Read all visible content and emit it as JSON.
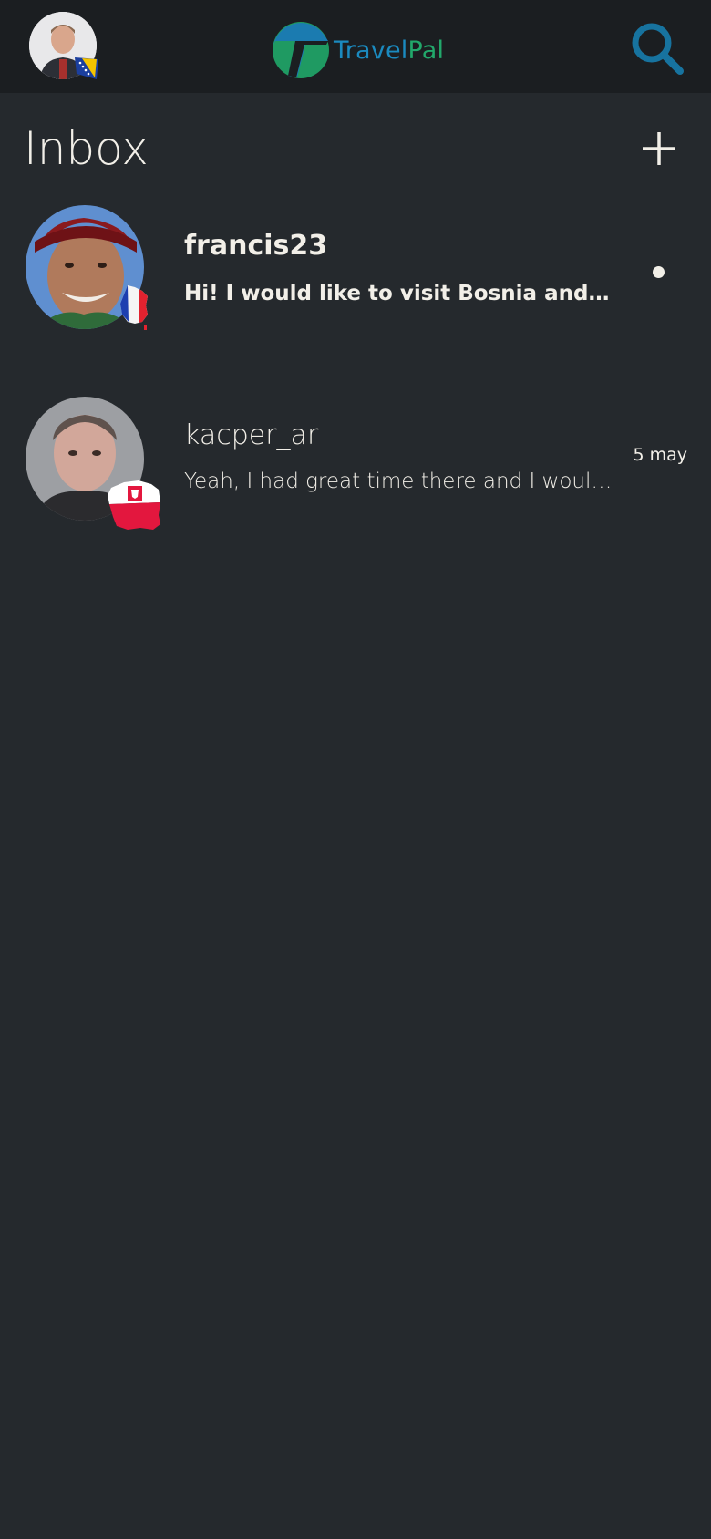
{
  "app": {
    "logo_text_part1": "Travel",
    "logo_text_part2": "Pal",
    "brand_colors": {
      "blue": "#1b8abf",
      "green": "#22a86b"
    }
  },
  "header": {
    "profile_avatar_icon": "user-avatar",
    "profile_flag": "bosnia-flag",
    "search_icon": "search-icon"
  },
  "inbox": {
    "title": "Inbox",
    "new_message_icon": "plus-icon"
  },
  "conversations": [
    {
      "username": "francis23",
      "preview": "Hi! I would like to visit Bosnia and Herzegovina",
      "unread": true,
      "timestamp": "",
      "flag": "france-map-flag"
    },
    {
      "username": "kacper_ar",
      "preview": "Yeah, I had great time there and I would recommend it",
      "unread": false,
      "timestamp": "5 may",
      "flag": "poland-map-flag"
    }
  ],
  "colors": {
    "background": "#25292d",
    "topbar": "#1b1e21",
    "text": "#f2efe8"
  }
}
